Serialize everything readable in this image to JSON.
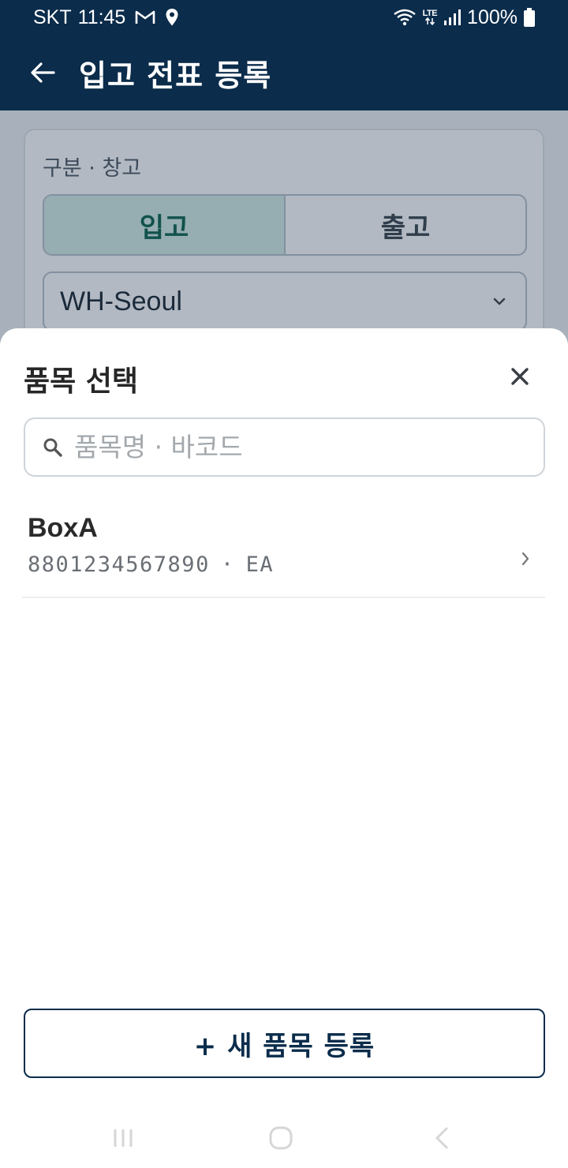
{
  "status_bar": {
    "carrier": "SKT",
    "time": "11:45",
    "network": "LTE",
    "battery": "100%",
    "icons": [
      "gmail-icon",
      "location-icon",
      "wifi-icon",
      "lte-icon",
      "signal-icon",
      "battery-icon"
    ]
  },
  "app_bar": {
    "title": "입고 전표 등록",
    "back_icon": "arrow-left-icon"
  },
  "form": {
    "section_label": "구분 · 창고",
    "segments": [
      {
        "label": "입고",
        "selected": true
      },
      {
        "label": "출고",
        "selected": false
      }
    ],
    "warehouse": {
      "selected": "WH-Seoul"
    }
  },
  "sheet": {
    "title": "품목 선택",
    "search": {
      "placeholder": "품목명 · 바코드",
      "value": ""
    },
    "items": [
      {
        "name": "BoxA",
        "barcode": "8801234567890",
        "separator": "·",
        "unit": "EA"
      }
    ],
    "new_item_label": "+ 새 품목 등록"
  },
  "colors": {
    "primary": "#0b2c4b",
    "accent_green": "#0f6650",
    "segment_active_bg": "#d6ede7"
  }
}
